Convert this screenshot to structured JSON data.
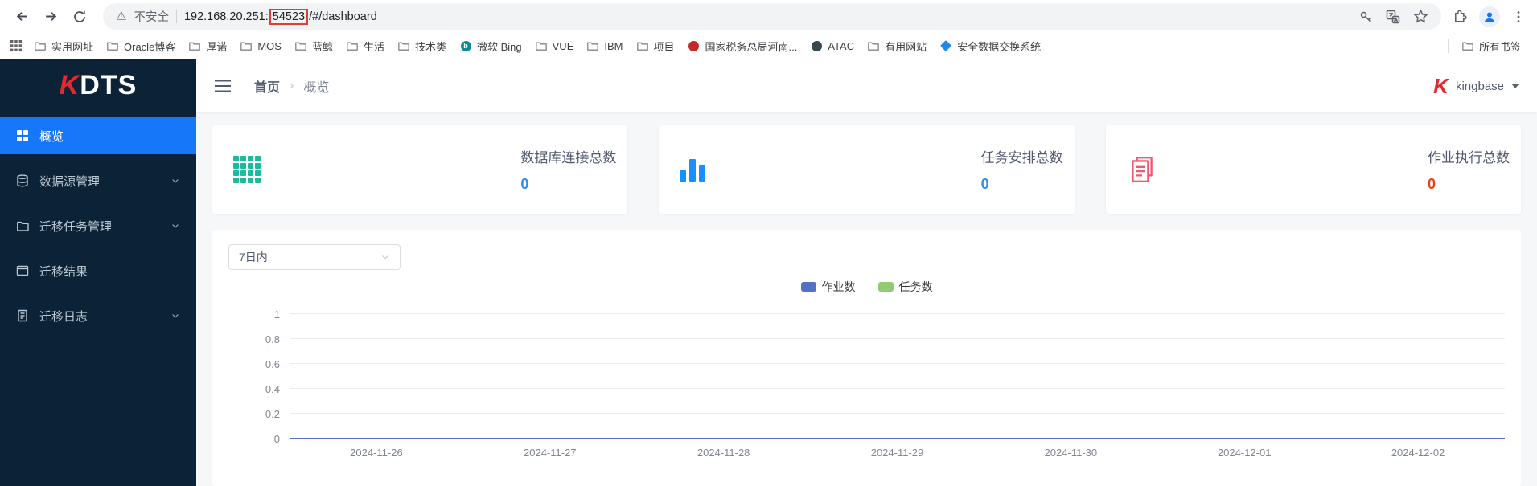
{
  "browser": {
    "security_label": "不安全",
    "url_host": "192.168.20.251:",
    "url_port": "54523",
    "url_path": "/#/dashboard",
    "bookmarks": [
      {
        "icon": "folder",
        "label": "实用网址"
      },
      {
        "icon": "folder",
        "label": "Oracle博客"
      },
      {
        "icon": "folder",
        "label": "厚诺"
      },
      {
        "icon": "folder",
        "label": "MOS"
      },
      {
        "icon": "folder",
        "label": "蓝鲸"
      },
      {
        "icon": "folder",
        "label": "生活"
      },
      {
        "icon": "folder",
        "label": "技术类"
      },
      {
        "icon": "bing",
        "label": "微软 Bing"
      },
      {
        "icon": "folder",
        "label": "VUE"
      },
      {
        "icon": "folder",
        "label": "IBM"
      },
      {
        "icon": "folder",
        "label": "项目"
      },
      {
        "icon": "tax",
        "label": "国家税务总局河南..."
      },
      {
        "icon": "atac",
        "label": "ATAC"
      },
      {
        "icon": "folder",
        "label": "有用网站"
      },
      {
        "icon": "shield",
        "label": "安全数据交换系统"
      }
    ],
    "all_bookmarks": {
      "icon": "folder",
      "label": "所有书签"
    }
  },
  "sidebar": {
    "logo_k": "K",
    "logo_rest": "DTS",
    "items": [
      {
        "label": "概览",
        "icon": "grid",
        "active": true,
        "chevron": false
      },
      {
        "label": "数据源管理",
        "icon": "database",
        "active": false,
        "chevron": true
      },
      {
        "label": "迁移任务管理",
        "icon": "folder",
        "active": false,
        "chevron": true
      },
      {
        "label": "迁移结果",
        "icon": "monitor",
        "active": false,
        "chevron": false
      },
      {
        "label": "迁移日志",
        "icon": "document",
        "active": false,
        "chevron": true
      }
    ]
  },
  "header": {
    "breadcrumb_home": "首页",
    "breadcrumb_sep": "›",
    "breadcrumb_current": "概览",
    "logo_k": "K",
    "user": "kingbase"
  },
  "cards": [
    {
      "title": "数据库连接总数",
      "value": "0",
      "icon": "grid",
      "icon_color": "#1abc9c",
      "value_color": "#2d8cf0"
    },
    {
      "title": "任务安排总数",
      "value": "0",
      "icon": "bars",
      "icon_color": "#1890ff",
      "value_color": "#2d8cf0"
    },
    {
      "title": "作业执行总数",
      "value": "0",
      "icon": "docs",
      "icon_color": "#f0596b",
      "value_color": "#ed4014"
    }
  ],
  "panel": {
    "range_select": "7日内"
  },
  "chart_data": {
    "type": "line",
    "x": [
      "2024-11-26",
      "2024-11-27",
      "2024-11-28",
      "2024-11-29",
      "2024-11-30",
      "2024-12-01",
      "2024-12-02"
    ],
    "series": [
      {
        "name": "作业数",
        "color": "#5470c6",
        "values": [
          0,
          0,
          0,
          0,
          0,
          0,
          0
        ]
      },
      {
        "name": "任务数",
        "color": "#91cc75",
        "values": [
          0,
          0,
          0,
          0,
          0,
          0,
          0
        ]
      }
    ],
    "ylim": [
      0,
      1
    ],
    "yticks": [
      0,
      0.2,
      0.4,
      0.6,
      0.8,
      1
    ],
    "legend_position": "top-center",
    "grid": true
  }
}
